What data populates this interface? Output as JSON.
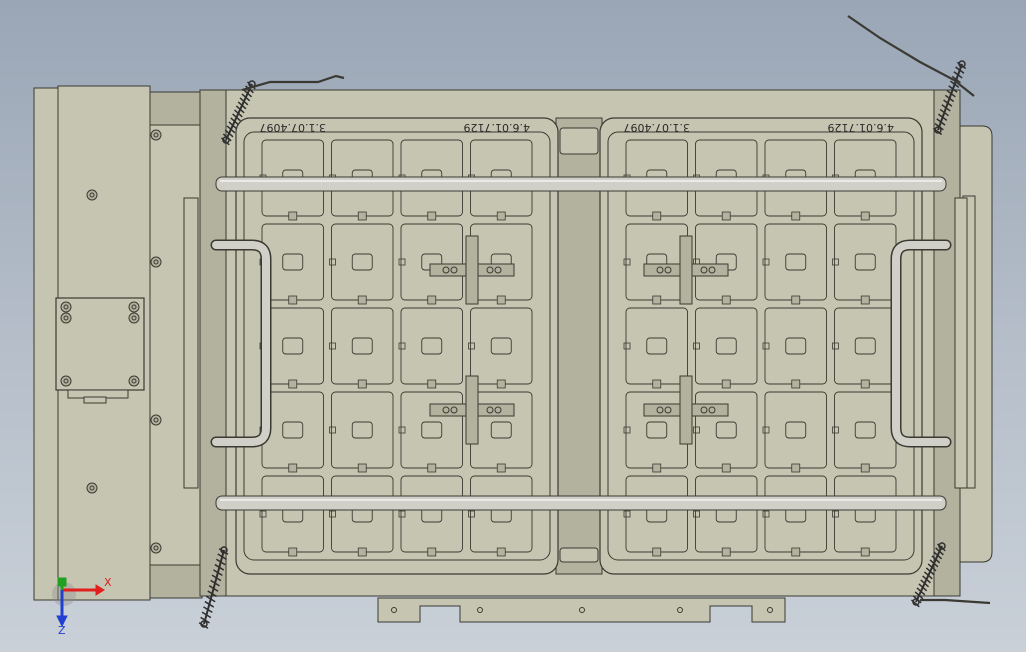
{
  "viewport": {
    "background_top": "#9aa6b6",
    "background_bottom": "#c9d0d8"
  },
  "colors": {
    "part_fill": "#c6c5b2",
    "part_fill_dark": "#b3b29f",
    "edge": "#3a3a32",
    "rod": "#d0d0c8",
    "spring": "#2f2f2f",
    "axis_x": "#e02020",
    "axis_y": "#20a020",
    "axis_z": "#2040d0"
  },
  "plates": [
    {
      "part_number_1": "4.6.01.7129",
      "part_number_2": "3.1.07.4097"
    },
    {
      "part_number_1": "4.6.01.7129",
      "part_number_2": "3.1.07.4097"
    }
  ],
  "axis_triad": {
    "x_label": "X",
    "z_label": "Z"
  }
}
